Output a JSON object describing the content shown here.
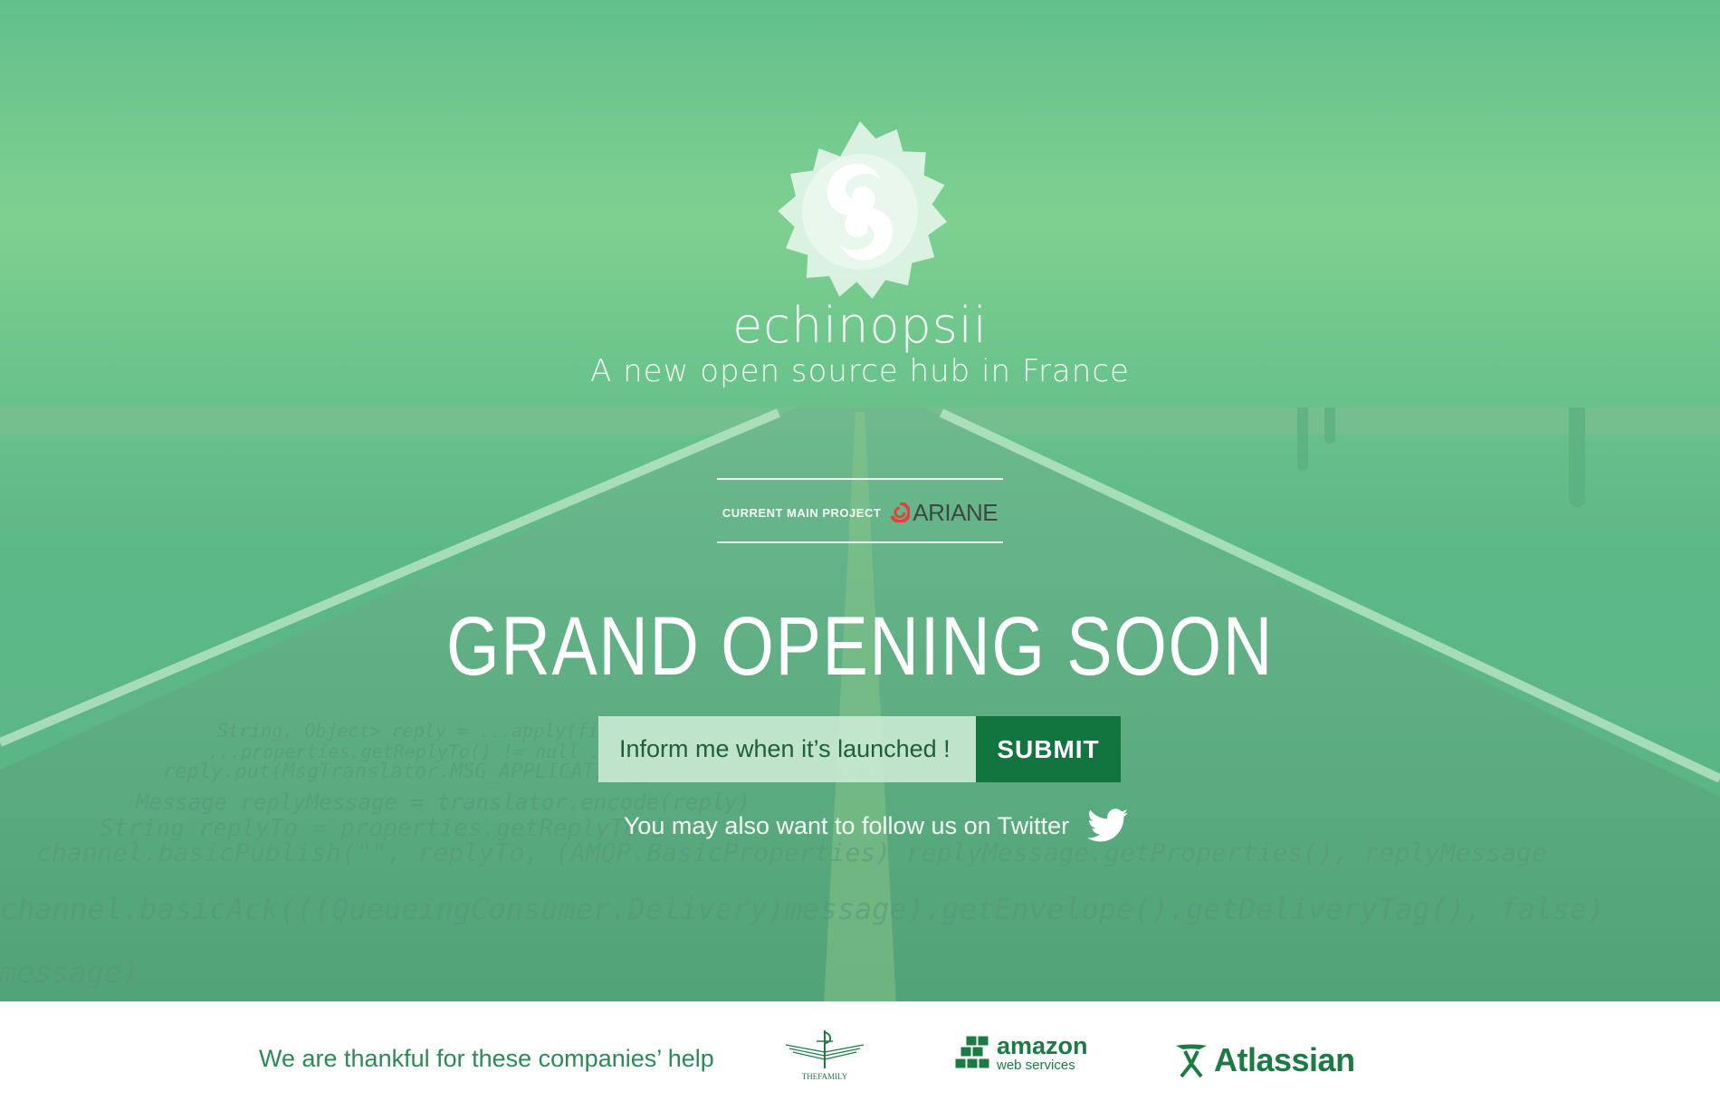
{
  "brand": {
    "name": "echinopsii",
    "tagline": "A new open source hub in France"
  },
  "project": {
    "label": "CURRENT MAIN PROJECT",
    "name": "ARIANE"
  },
  "headline": "GRAND OPENING SOON",
  "signup": {
    "placeholder": "Inform me when it’s launched !",
    "submit_label": "SUBMIT"
  },
  "twitter": {
    "text": "You may also want to follow us on Twitter"
  },
  "footer": {
    "thanks": "We are thankful for these companies’ help",
    "sponsors": [
      {
        "name": "THEFAMILY"
      },
      {
        "name": "amazon",
        "sub": "web services"
      },
      {
        "name": "Atlassian"
      }
    ]
  },
  "background_code": [
    "String, Object> reply = ...apply(finalMessage)",
    "...properties.getReplyTo() != null ...  && replyTo != null) {",
    "reply.put(MsgTranslator.MSG_APPLICATION_ID, client.getClientID())",
    "Message replyMessage = translator.encode(reply)",
    "String replyTo = properties.getReplyTo()",
    "channel.basicPublish(\"\", replyTo, (AMQP.BasicProperties) replyMessage.getProperties(), replyMessage",
    "channel.basicAck(((QueueingConsumer.Delivery)message).getEnvelope().getDeliveryTag(), false)",
    "(message)"
  ],
  "colors": {
    "overlay_green": "#5db888",
    "submit_green": "#127540",
    "footer_text": "#2d8a57",
    "ariane_red": "#e0433b"
  }
}
